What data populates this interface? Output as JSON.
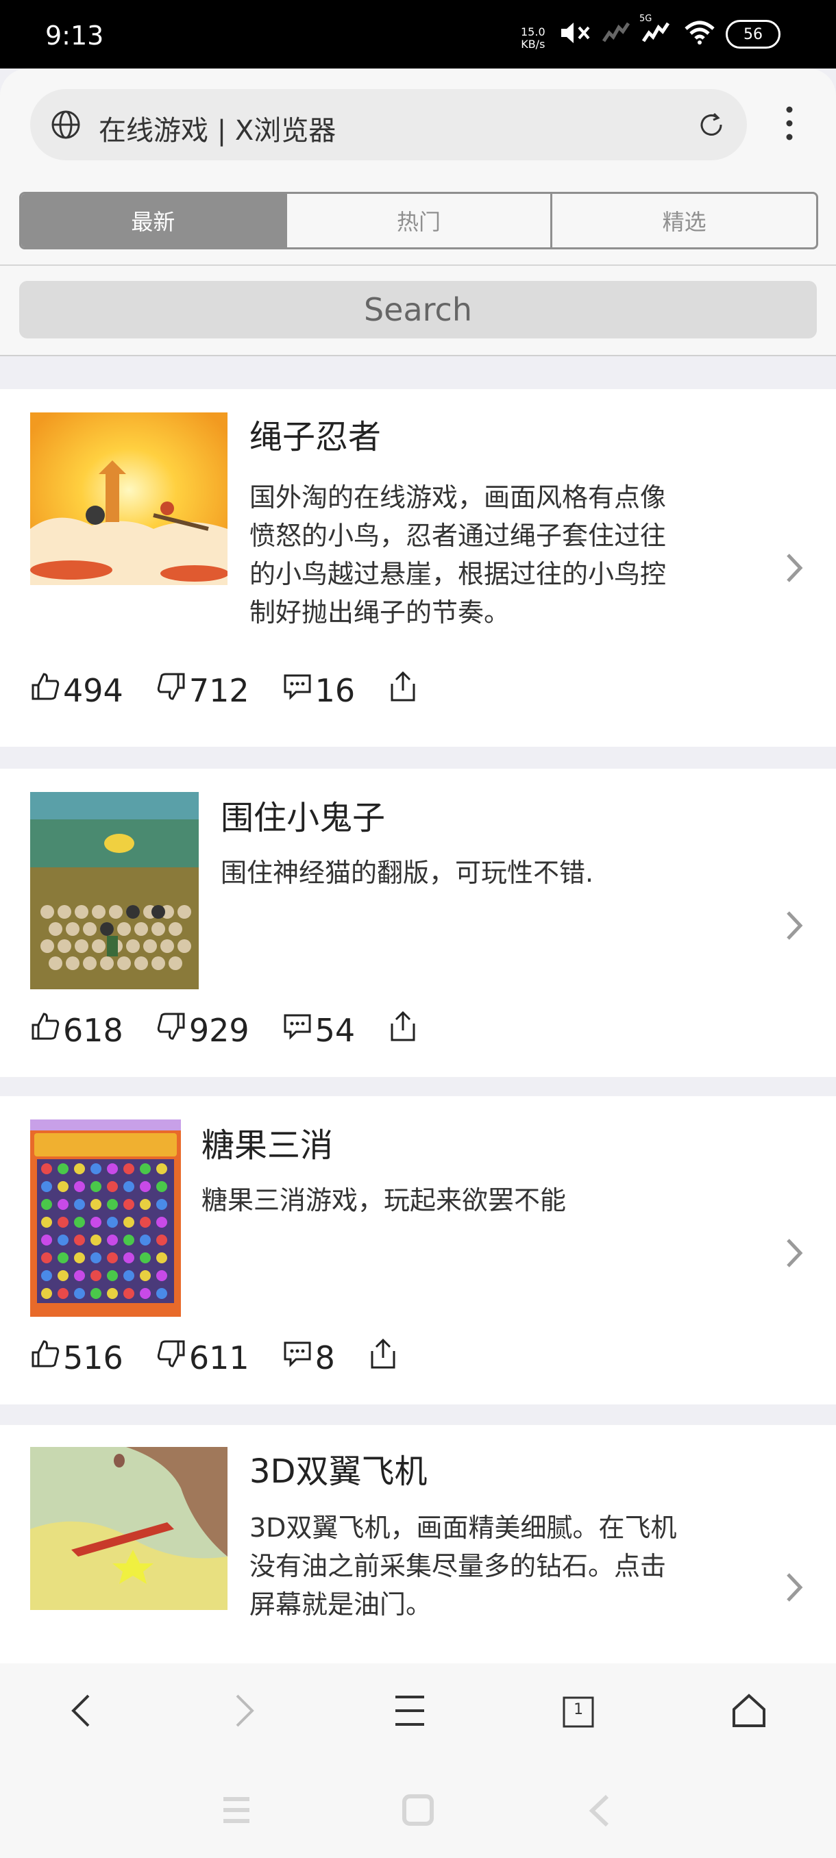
{
  "status": {
    "time": "9:13",
    "net_speed_value": "15.0",
    "net_speed_unit": "KB/s",
    "network": "5G",
    "battery": "56"
  },
  "browser": {
    "page_title": "在线游戏 | X浏览器"
  },
  "tabs": [
    {
      "label": "最新",
      "active": true
    },
    {
      "label": "热门",
      "active": false
    },
    {
      "label": "精选",
      "active": false
    }
  ],
  "search": {
    "placeholder": "Search"
  },
  "games": [
    {
      "name": "绳子忍者",
      "desc": "国外淘的在线游戏，画面风格有点像愤怒的小鸟，忍者通过绳子套住过往的小鸟越过悬崖，根据过往的小鸟控制好抛出绳子的节奏。",
      "likes": "494",
      "dislikes": "712",
      "comments": "16"
    },
    {
      "name": "围住小鬼子",
      "desc": "围住神经猫的翻版，可玩性不错.",
      "likes": "618",
      "dislikes": "929",
      "comments": "54"
    },
    {
      "name": "糖果三消",
      "desc": "糖果三消游戏，玩起来欲罢不能",
      "likes": "516",
      "dislikes": "611",
      "comments": "8"
    },
    {
      "name": "3D双翼飞机",
      "desc": "3D双翼飞机，画面精美细腻。在飞机没有油之前采集尽量多的钻石。点击屏幕就是油门。"
    }
  ],
  "toolbar": {
    "tab_count": "1"
  },
  "colors": {
    "segment": "#8f8f8f",
    "background": "#efeff4"
  }
}
